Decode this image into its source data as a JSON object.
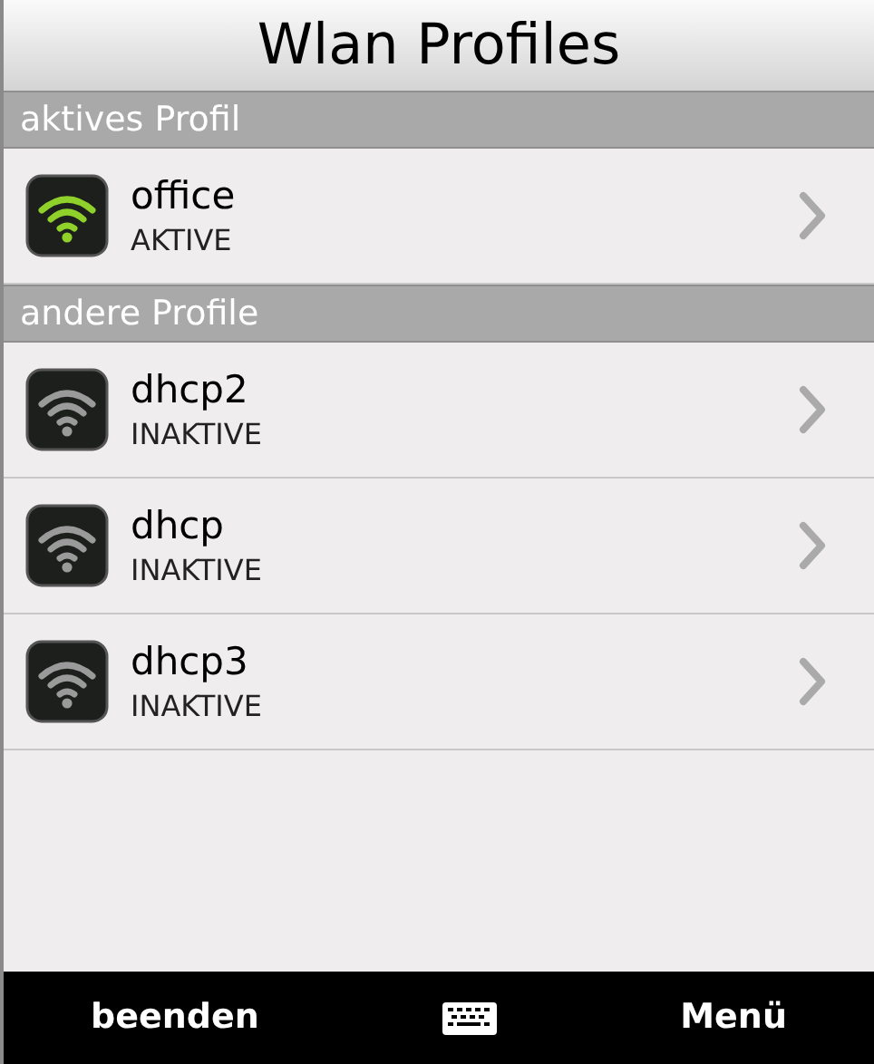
{
  "window": {
    "title": "Wlan Profiles"
  },
  "sections": [
    {
      "title": "aktives Profil",
      "profiles": [
        {
          "name": "office",
          "status": "AKTIVE",
          "active": true
        }
      ]
    },
    {
      "title": "andere Profile",
      "profiles": [
        {
          "name": "dhcp2",
          "status": "INAKTIVE",
          "active": false
        },
        {
          "name": "dhcp",
          "status": "INAKTIVE",
          "active": false
        },
        {
          "name": "dhcp3",
          "status": "INAKTIVE",
          "active": false
        }
      ]
    }
  ],
  "softkeys": {
    "left": "beenden",
    "right": "Menü"
  }
}
